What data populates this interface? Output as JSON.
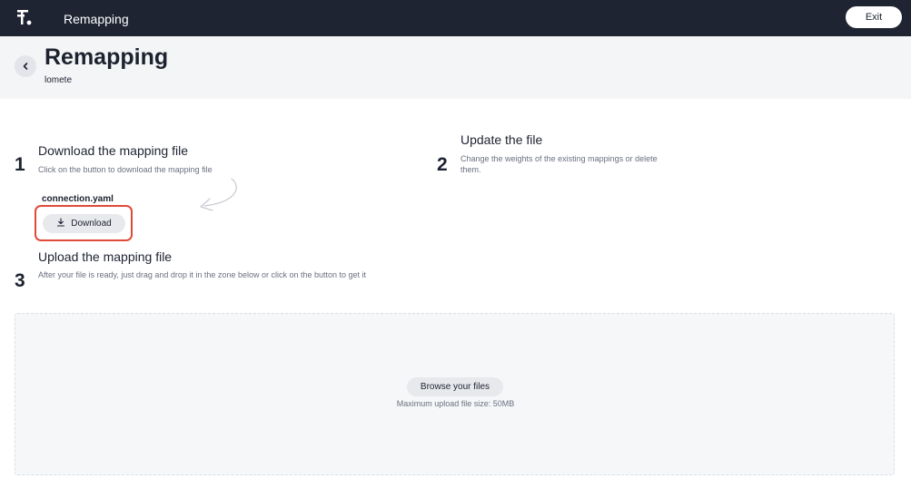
{
  "app": {
    "title": "Remapping",
    "exit_label": "Exit"
  },
  "header": {
    "title": "Remapping",
    "subtitle": "lomete"
  },
  "steps": [
    {
      "number": "1",
      "title": "Download the mapping file",
      "description": "Click on the button to download the mapping file"
    },
    {
      "number": "2",
      "title": "Update the file",
      "description": "Change the weights of the existing mappings or delete them."
    },
    {
      "number": "3",
      "title": "Upload the mapping file",
      "description": "After your file is ready, just drag and drop it in the zone below or click on the button to get it"
    }
  ],
  "download": {
    "file_name": "connection.yaml",
    "button_label": "Download"
  },
  "upload": {
    "browse_label": "Browse your files",
    "max_size_note": "Maximum upload file size: 50MB"
  },
  "icons": {
    "logo": "brand-logo-icon",
    "back": "chevron-left-icon",
    "download": "download-icon",
    "arrow": "curved-arrow-icon"
  },
  "colors": {
    "topbar": "#1f2433",
    "highlight": "#e04a3a",
    "button_bg": "#e8e9ed",
    "header_bg": "#f4f5f7"
  }
}
